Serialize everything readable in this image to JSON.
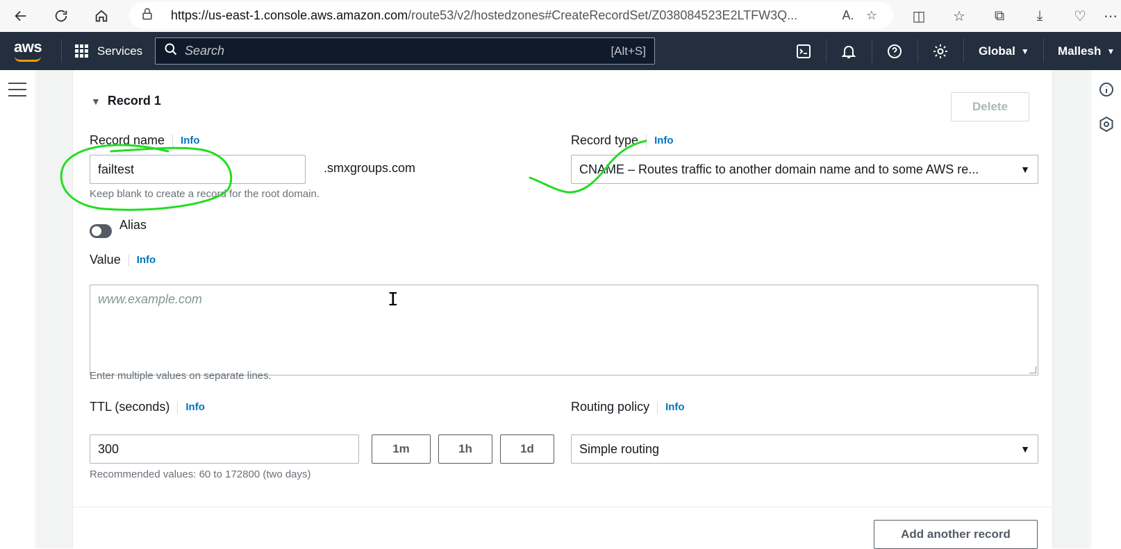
{
  "browser": {
    "url_host": "https://us-east-1.console.aws.amazon.com",
    "url_path": "/route53/v2/hostedzones#CreateRecordSet/Z038084523E2LTFW3Q..."
  },
  "aws_nav": {
    "logo": "aws",
    "services_label": "Services",
    "search_placeholder": "Search",
    "search_shortcut": "[Alt+S]",
    "region_label": "Global",
    "account_label": "Mallesh"
  },
  "record": {
    "title": "Record 1",
    "delete_label": "Delete",
    "record_name_label": "Record name",
    "record_name_value": "failtest",
    "domain_suffix": ".smxgroups.com",
    "record_name_hint": "Keep blank to create a record for the root domain.",
    "record_type_label": "Record type",
    "record_type_value": "CNAME – Routes traffic to another domain name and to some AWS re...",
    "alias_label": "Alias",
    "value_label": "Value",
    "value_placeholder": "www.example.com",
    "value_hint": "Enter multiple values on separate lines.",
    "ttl_label": "TTL (seconds)",
    "ttl_value": "300",
    "ttl_1m": "1m",
    "ttl_1h": "1h",
    "ttl_1d": "1d",
    "ttl_hint": "Recommended values: 60 to 172800 (two days)",
    "routing_label": "Routing policy",
    "routing_value": "Simple routing",
    "info_label": "Info",
    "add_label": "Add another record"
  },
  "colors": {
    "nav_bg": "#232f3e",
    "link": "#0073bb",
    "annotation": "#22dd22"
  }
}
